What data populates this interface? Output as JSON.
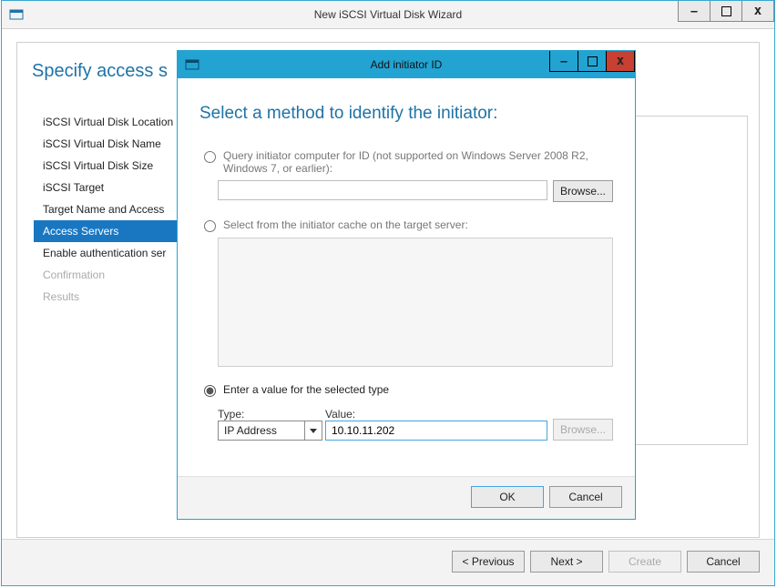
{
  "main": {
    "title": "New iSCSI Virtual Disk Wizard",
    "heading": "Specify access s"
  },
  "steps": [
    {
      "label": "iSCSI Virtual Disk Location",
      "disabled": false,
      "selected": false
    },
    {
      "label": "iSCSI Virtual Disk Name",
      "disabled": false,
      "selected": false
    },
    {
      "label": "iSCSI Virtual Disk Size",
      "disabled": false,
      "selected": false
    },
    {
      "label": "iSCSI Target",
      "disabled": false,
      "selected": false
    },
    {
      "label": "Target Name and Access",
      "disabled": false,
      "selected": false
    },
    {
      "label": "Access Servers",
      "disabled": false,
      "selected": true
    },
    {
      "label": "Enable authentication ser",
      "disabled": false,
      "selected": false
    },
    {
      "label": "Confirmation",
      "disabled": true,
      "selected": false
    },
    {
      "label": "Results",
      "disabled": true,
      "selected": false
    }
  ],
  "footer": {
    "previous": "< Previous",
    "next": "Next >",
    "create": "Create",
    "cancel": "Cancel"
  },
  "modal": {
    "title": "Add initiator ID",
    "heading": "Select a method to identify the initiator:",
    "opt1": "Query initiator computer for ID (not supported on Windows Server 2008 R2, Windows 7, or earlier):",
    "opt1_browse": "Browse...",
    "opt2": "Select from the initiator cache on the target server:",
    "opt3": "Enter a value for the selected type",
    "type_label": "Type:",
    "value_label": "Value:",
    "type_value": "IP Address",
    "value_value": "10.10.11.202",
    "opt3_browse": "Browse...",
    "ok": "OK",
    "cancel": "Cancel"
  }
}
